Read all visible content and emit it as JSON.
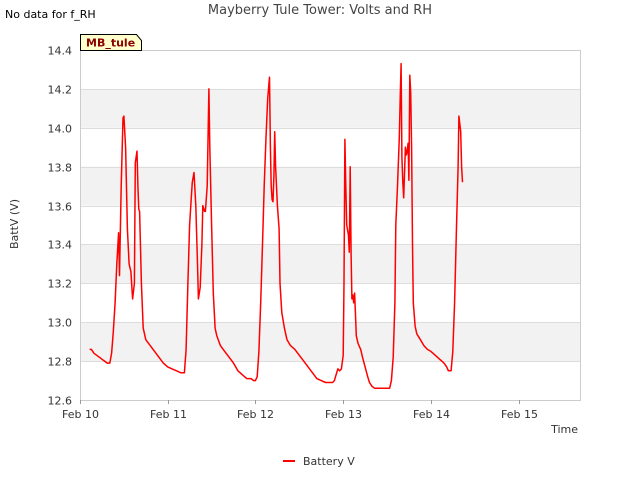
{
  "note": "No data for f_RH",
  "site_tag": "MB_tule",
  "colors": {
    "series": "#ff0000",
    "band": "#f2f2f2",
    "grid": "#dddddd",
    "tag_fill": "#ffffcc"
  },
  "chart_data": {
    "type": "line",
    "title": "Mayberry Tule Tower: Volts and RH",
    "xlabel": "Time",
    "ylabel": "BattV (V)",
    "x_unit": "days from Feb 10 00:00",
    "xlim": [
      0,
      5.7
    ],
    "ylim": [
      12.6,
      14.4
    ],
    "xticks": [
      {
        "v": 0,
        "label": "Feb 10"
      },
      {
        "v": 1,
        "label": "Feb 11"
      },
      {
        "v": 2,
        "label": "Feb 12"
      },
      {
        "v": 3,
        "label": "Feb 13"
      },
      {
        "v": 4,
        "label": "Feb 14"
      },
      {
        "v": 5,
        "label": "Feb 15"
      }
    ],
    "yticks": [
      "12.6",
      "12.8",
      "13.0",
      "13.2",
      "13.4",
      "13.6",
      "13.8",
      "14.0",
      "14.2",
      "14.4"
    ],
    "grid": true,
    "legend_position": "bottom-center",
    "series": [
      {
        "name": "Battery V",
        "points": [
          [
            0.11,
            12.86
          ],
          [
            0.13,
            12.86
          ],
          [
            0.16,
            12.84
          ],
          [
            0.19,
            12.83
          ],
          [
            0.22,
            12.82
          ],
          [
            0.25,
            12.81
          ],
          [
            0.28,
            12.8
          ],
          [
            0.31,
            12.79
          ],
          [
            0.34,
            12.79
          ],
          [
            0.36,
            12.84
          ],
          [
            0.38,
            12.95
          ],
          [
            0.4,
            13.1
          ],
          [
            0.42,
            13.3
          ],
          [
            0.44,
            13.46
          ],
          [
            0.45,
            13.24
          ],
          [
            0.47,
            13.7
          ],
          [
            0.49,
            14.05
          ],
          [
            0.5,
            14.06
          ],
          [
            0.52,
            13.9
          ],
          [
            0.54,
            13.48
          ],
          [
            0.56,
            13.3
          ],
          [
            0.58,
            13.26
          ],
          [
            0.6,
            13.12
          ],
          [
            0.62,
            13.2
          ],
          [
            0.63,
            13.82
          ],
          [
            0.65,
            13.88
          ],
          [
            0.66,
            13.7
          ],
          [
            0.67,
            13.58
          ],
          [
            0.68,
            13.57
          ],
          [
            0.7,
            13.2
          ],
          [
            0.72,
            12.97
          ],
          [
            0.75,
            12.91
          ],
          [
            0.8,
            12.88
          ],
          [
            0.85,
            12.85
          ],
          [
            0.9,
            12.82
          ],
          [
            0.95,
            12.79
          ],
          [
            1.0,
            12.77
          ],
          [
            1.05,
            12.76
          ],
          [
            1.1,
            12.75
          ],
          [
            1.15,
            12.74
          ],
          [
            1.17,
            12.74
          ],
          [
            1.19,
            12.74
          ],
          [
            1.21,
            12.86
          ],
          [
            1.23,
            13.2
          ],
          [
            1.25,
            13.5
          ],
          [
            1.27,
            13.65
          ],
          [
            1.28,
            13.72
          ],
          [
            1.3,
            13.77
          ],
          [
            1.32,
            13.6
          ],
          [
            1.34,
            13.3
          ],
          [
            1.35,
            13.12
          ],
          [
            1.37,
            13.18
          ],
          [
            1.39,
            13.4
          ],
          [
            1.4,
            13.6
          ],
          [
            1.42,
            13.57
          ],
          [
            1.43,
            13.57
          ],
          [
            1.45,
            13.7
          ],
          [
            1.47,
            14.2
          ],
          [
            1.48,
            13.9
          ],
          [
            1.5,
            13.5
          ],
          [
            1.52,
            13.15
          ],
          [
            1.54,
            12.97
          ],
          [
            1.56,
            12.93
          ],
          [
            1.6,
            12.88
          ],
          [
            1.65,
            12.85
          ],
          [
            1.7,
            12.82
          ],
          [
            1.75,
            12.79
          ],
          [
            1.8,
            12.75
          ],
          [
            1.85,
            12.73
          ],
          [
            1.9,
            12.71
          ],
          [
            1.95,
            12.71
          ],
          [
            1.98,
            12.7
          ],
          [
            2.0,
            12.7
          ],
          [
            2.02,
            12.72
          ],
          [
            2.04,
            12.85
          ],
          [
            2.06,
            13.1
          ],
          [
            2.08,
            13.4
          ],
          [
            2.1,
            13.7
          ],
          [
            2.12,
            13.95
          ],
          [
            2.14,
            14.15
          ],
          [
            2.16,
            14.26
          ],
          [
            2.17,
            13.9
          ],
          [
            2.18,
            13.7
          ],
          [
            2.19,
            13.63
          ],
          [
            2.2,
            13.62
          ],
          [
            2.21,
            13.75
          ],
          [
            2.22,
            13.98
          ],
          [
            2.23,
            13.8
          ],
          [
            2.25,
            13.6
          ],
          [
            2.27,
            13.48
          ],
          [
            2.28,
            13.2
          ],
          [
            2.3,
            13.05
          ],
          [
            2.33,
            12.97
          ],
          [
            2.36,
            12.91
          ],
          [
            2.4,
            12.88
          ],
          [
            2.45,
            12.86
          ],
          [
            2.5,
            12.83
          ],
          [
            2.55,
            12.8
          ],
          [
            2.6,
            12.77
          ],
          [
            2.65,
            12.74
          ],
          [
            2.7,
            12.71
          ],
          [
            2.75,
            12.7
          ],
          [
            2.8,
            12.69
          ],
          [
            2.85,
            12.69
          ],
          [
            2.88,
            12.69
          ],
          [
            2.9,
            12.7
          ],
          [
            2.92,
            12.73
          ],
          [
            2.94,
            12.76
          ],
          [
            2.96,
            12.75
          ],
          [
            2.98,
            12.76
          ],
          [
            3.0,
            12.83
          ],
          [
            3.01,
            13.2
          ],
          [
            3.02,
            13.94
          ],
          [
            3.03,
            13.7
          ],
          [
            3.04,
            13.5
          ],
          [
            3.06,
            13.45
          ],
          [
            3.07,
            13.36
          ],
          [
            3.08,
            13.8
          ],
          [
            3.09,
            13.35
          ],
          [
            3.1,
            13.12
          ],
          [
            3.11,
            13.14
          ],
          [
            3.12,
            13.1
          ],
          [
            3.13,
            13.15
          ],
          [
            3.14,
            13.05
          ],
          [
            3.15,
            12.93
          ],
          [
            3.17,
            12.89
          ],
          [
            3.19,
            12.87
          ],
          [
            3.2,
            12.86
          ],
          [
            3.22,
            12.82
          ],
          [
            3.25,
            12.77
          ],
          [
            3.28,
            12.72
          ],
          [
            3.3,
            12.69
          ],
          [
            3.33,
            12.67
          ],
          [
            3.36,
            12.66
          ],
          [
            3.4,
            12.66
          ],
          [
            3.45,
            12.66
          ],
          [
            3.5,
            12.66
          ],
          [
            3.53,
            12.66
          ],
          [
            3.55,
            12.7
          ],
          [
            3.57,
            12.82
          ],
          [
            3.59,
            13.1
          ],
          [
            3.6,
            13.5
          ],
          [
            3.62,
            13.7
          ],
          [
            3.64,
            13.95
          ],
          [
            3.65,
            14.15
          ],
          [
            3.66,
            14.33
          ],
          [
            3.67,
            13.85
          ],
          [
            3.68,
            13.72
          ],
          [
            3.69,
            13.64
          ],
          [
            3.71,
            13.9
          ],
          [
            3.72,
            13.86
          ],
          [
            3.73,
            13.88
          ],
          [
            3.74,
            13.92
          ],
          [
            3.75,
            13.73
          ],
          [
            3.76,
            14.27
          ],
          [
            3.77,
            14.18
          ],
          [
            3.78,
            13.9
          ],
          [
            3.79,
            13.4
          ],
          [
            3.8,
            13.1
          ],
          [
            3.82,
            12.98
          ],
          [
            3.84,
            12.94
          ],
          [
            3.88,
            12.91
          ],
          [
            3.92,
            12.88
          ],
          [
            3.96,
            12.86
          ],
          [
            4.0,
            12.85
          ],
          [
            4.05,
            12.83
          ],
          [
            4.1,
            12.81
          ],
          [
            4.15,
            12.79
          ],
          [
            4.18,
            12.77
          ],
          [
            4.2,
            12.75
          ],
          [
            4.23,
            12.75
          ],
          [
            4.25,
            12.85
          ],
          [
            4.27,
            13.1
          ],
          [
            4.29,
            13.45
          ],
          [
            4.31,
            13.8
          ],
          [
            4.32,
            14.06
          ],
          [
            4.34,
            13.98
          ],
          [
            4.35,
            13.8
          ],
          [
            4.36,
            13.72
          ]
        ]
      }
    ]
  }
}
